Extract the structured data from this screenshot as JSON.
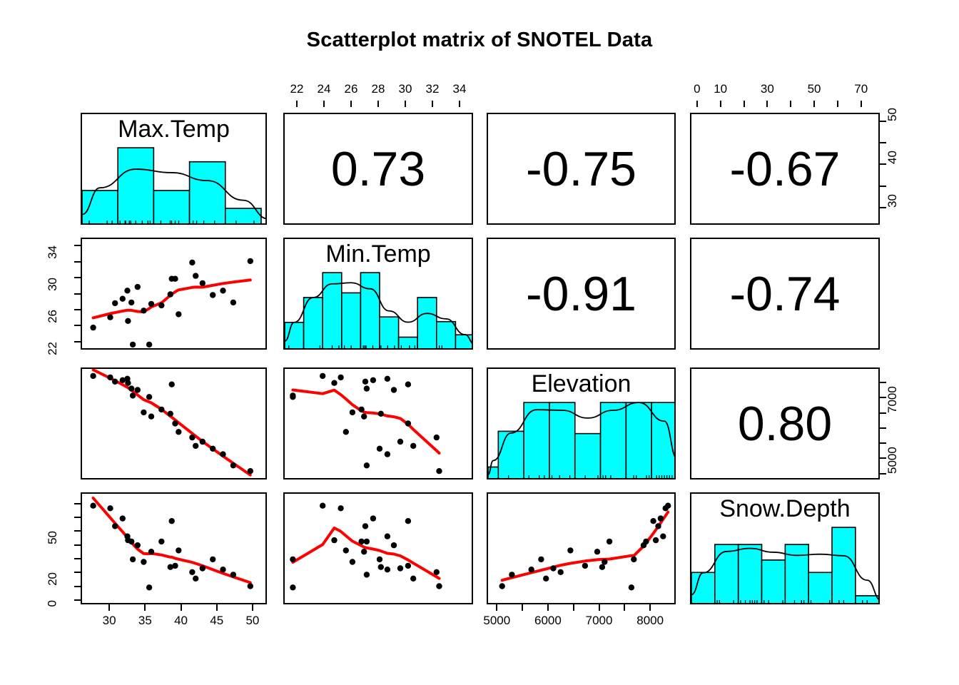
{
  "title": "Scatterplot matrix of SNOTEL Data",
  "variables": [
    "Max.Temp",
    "Min.Temp",
    "Elevation",
    "Snow.Depth"
  ],
  "colors": {
    "histogram_fill": "#00e5ee",
    "histogram_fill_exact": "#00FFFF",
    "smoother_line": "#FF0000",
    "point": "#000000",
    "density_line": "#000000",
    "frame": "#000000",
    "background": "#FFFFFF"
  },
  "axes": {
    "min_temp_top": {
      "labels": [
        "22",
        "24",
        "26",
        "28",
        "30",
        "32",
        "34"
      ],
      "tick_values": [
        22,
        24,
        26,
        28,
        30,
        32,
        34
      ],
      "range": [
        21,
        35
      ]
    },
    "snow_depth_top": {
      "labels": [
        "0",
        "10",
        "",
        "30",
        "",
        "50",
        "",
        "70"
      ],
      "tick_values": [
        0,
        10,
        20,
        30,
        40,
        50,
        60,
        70
      ],
      "range": [
        -3,
        78
      ]
    },
    "max_temp_right": {
      "labels": [
        "30",
        "",
        "40",
        "",
        "50"
      ],
      "tick_values": [
        30,
        35,
        40,
        45,
        50
      ],
      "range": [
        26,
        52
      ]
    },
    "min_temp_left": {
      "labels": [
        "22",
        "",
        "26",
        "",
        "30",
        "",
        "34"
      ],
      "tick_values": [
        22,
        24,
        26,
        28,
        30,
        32,
        34
      ],
      "range": [
        21,
        35
      ]
    },
    "elevation_right": {
      "labels": [
        "5000",
        "",
        "",
        "",
        "7000",
        "",
        ""
      ],
      "tick_values": [
        5000,
        5500,
        6000,
        6500,
        7000,
        7500,
        8000
      ],
      "range": [
        4800,
        8500
      ]
    },
    "snow_depth_left": {
      "labels": [
        "0",
        "",
        "20",
        "",
        "",
        "50",
        "",
        ""
      ],
      "tick_values": [
        0,
        10,
        20,
        30,
        40,
        50,
        60,
        70
      ],
      "range": [
        -3,
        78
      ]
    },
    "max_temp_bottom": {
      "labels": [
        "30",
        "35",
        "40",
        "45",
        "50"
      ],
      "tick_values": [
        30,
        35,
        40,
        45,
        50
      ],
      "range": [
        26,
        52
      ]
    },
    "elevation_bottom": {
      "labels": [
        "5000",
        "",
        "6000",
        "",
        "7000",
        "",
        "8000"
      ],
      "tick_values": [
        5000,
        5500,
        6000,
        6500,
        7000,
        7500,
        8000
      ],
      "range": [
        4800,
        8500
      ]
    }
  },
  "correlations": {
    "max_min": "0.73",
    "max_elev": "-0.75",
    "max_snow": "-0.67",
    "min_elev": "-0.91",
    "min_snow": "-0.74",
    "elev_snow": "0.80"
  },
  "chart_data": {
    "type": "scatter",
    "title": "Scatterplot matrix of SNOTEL Data",
    "plot_kind": "scatterplot-matrix",
    "variables": [
      "Max.Temp",
      "Min.Temp",
      "Elevation",
      "Snow.Depth"
    ],
    "n_points": 22,
    "xlabel": "",
    "ylabel": "",
    "grid": false,
    "legend": "none",
    "panels": {
      "upper_triangle": "pearson correlation coefficients",
      "diagonal": "histogram with density curve",
      "lower_triangle": "scatterplot with lowess smoother"
    },
    "correlation_matrix": [
      [
        null,
        0.73,
        -0.75,
        -0.67
      ],
      [
        0.73,
        null,
        -0.91,
        -0.74
      ],
      [
        -0.75,
        -0.91,
        null,
        0.8
      ],
      [
        -0.67,
        -0.74,
        0.8,
        null
      ]
    ],
    "axis_ranges": {
      "Max.Temp": [
        26,
        52
      ],
      "Min.Temp": [
        21,
        35
      ],
      "Elevation": [
        4800,
        8500
      ],
      "Snow.Depth": [
        -3,
        78
      ]
    },
    "observations": [
      {
        "Max.Temp": 27.0,
        "Min.Temp": 23.6,
        "Elevation": 8400,
        "Snow.Depth": 72
      },
      {
        "Max.Temp": 29.5,
        "Min.Temp": 25.0,
        "Elevation": 8350,
        "Snow.Depth": 70
      },
      {
        "Max.Temp": 30.2,
        "Min.Temp": 26.9,
        "Elevation": 8200,
        "Snow.Depth": 56
      },
      {
        "Max.Temp": 31.3,
        "Min.Temp": 27.5,
        "Elevation": 8250,
        "Snow.Depth": 62
      },
      {
        "Max.Temp": 32.0,
        "Min.Temp": 28.6,
        "Elevation": 8300,
        "Snow.Depth": 48
      },
      {
        "Max.Temp": 32.1,
        "Min.Temp": 24.5,
        "Elevation": 8150,
        "Snow.Depth": 45
      },
      {
        "Max.Temp": 32.6,
        "Min.Temp": 27.0,
        "Elevation": 7950,
        "Snow.Depth": 44
      },
      {
        "Max.Temp": 32.8,
        "Min.Temp": 21.3,
        "Elevation": 7700,
        "Snow.Depth": 30
      },
      {
        "Max.Temp": 33.5,
        "Min.Temp": 29.1,
        "Elevation": 7900,
        "Snow.Depth": 41
      },
      {
        "Max.Temp": 34.4,
        "Min.Temp": 25.9,
        "Elevation": 7100,
        "Snow.Depth": 28
      },
      {
        "Max.Temp": 35.2,
        "Min.Temp": 21.3,
        "Elevation": 7650,
        "Snow.Depth": 8
      },
      {
        "Max.Temp": 35.5,
        "Min.Temp": 26.8,
        "Elevation": 6950,
        "Snow.Depth": 36
      },
      {
        "Max.Temp": 37.0,
        "Min.Temp": 26.6,
        "Elevation": 7200,
        "Snow.Depth": 44
      },
      {
        "Max.Temp": 38.3,
        "Min.Temp": 28.1,
        "Elevation": 7050,
        "Snow.Depth": 24
      },
      {
        "Max.Temp": 38.5,
        "Min.Temp": 30.2,
        "Elevation": 8100,
        "Snow.Depth": 60
      },
      {
        "Max.Temp": 39.0,
        "Min.Temp": 30.2,
        "Elevation": 6700,
        "Snow.Depth": 25
      },
      {
        "Max.Temp": 39.5,
        "Min.Temp": 25.4,
        "Elevation": 6400,
        "Snow.Depth": 37
      },
      {
        "Max.Temp": 41.5,
        "Min.Temp": 32.4,
        "Elevation": 6200,
        "Snow.Depth": 20
      },
      {
        "Max.Temp": 42.0,
        "Min.Temp": 30.6,
        "Elevation": 5900,
        "Snow.Depth": 15
      },
      {
        "Max.Temp": 43.0,
        "Min.Temp": 29.6,
        "Elevation": 6050,
        "Snow.Depth": 23
      },
      {
        "Max.Temp": 44.5,
        "Min.Temp": 28.0,
        "Elevation": 5800,
        "Snow.Depth": 30
      },
      {
        "Max.Temp": 46.0,
        "Min.Temp": 28.6,
        "Elevation": 5600,
        "Snow.Depth": 22
      },
      {
        "Max.Temp": 47.5,
        "Min.Temp": 27.0,
        "Elevation": 5200,
        "Snow.Depth": 18
      },
      {
        "Max.Temp": 50.0,
        "Min.Temp": 32.6,
        "Elevation": 5000,
        "Snow.Depth": 9
      }
    ],
    "histograms": {
      "Max.Temp": {
        "bin_edges": [
          26,
          31,
          36,
          41,
          46,
          51
        ],
        "counts": [
          4,
          9,
          4,
          7.4,
          2
        ],
        "heights_rel": [
          0.45,
          1.0,
          0.45,
          0.82,
          0.22
        ],
        "density_curve": true
      },
      "Min.Temp": {
        "bin_edges": [
          21,
          22.4,
          23.8,
          25.2,
          26.6,
          28.0,
          29.4,
          30.8,
          32.2,
          33.6,
          35.0
        ],
        "counts": [
          1,
          2,
          3,
          2,
          3,
          1.3,
          0.5,
          2,
          1,
          0.6
        ],
        "heights_rel": [
          0.36,
          0.68,
          1.0,
          0.74,
          1.0,
          0.43,
          0.17,
          0.68,
          0.37,
          0.2
        ],
        "density_curve": true
      },
      "Elevation": {
        "bin_edges": [
          4800,
          5000,
          5500,
          6000,
          6500,
          7000,
          7500,
          8000,
          8500
        ],
        "counts": [
          0.5,
          2,
          3.3,
          3.3,
          2,
          3.3,
          3.3,
          3.3
        ],
        "heights_rel": [
          0.17,
          0.63,
          1.0,
          1.0,
          0.6,
          1.0,
          1.0,
          1.0
        ],
        "density_curve": true
      },
      "Snow.Depth": {
        "bin_edges": [
          -3,
          7,
          17,
          27,
          37,
          47,
          57,
          67,
          77
        ],
        "counts": [
          2,
          3.7,
          3.7,
          2.8,
          3.7,
          2,
          4.8,
          0.6
        ],
        "heights_rel": [
          0.42,
          0.78,
          0.78,
          0.58,
          0.78,
          0.42,
          1.0,
          0.12
        ],
        "density_curve": true
      }
    }
  }
}
